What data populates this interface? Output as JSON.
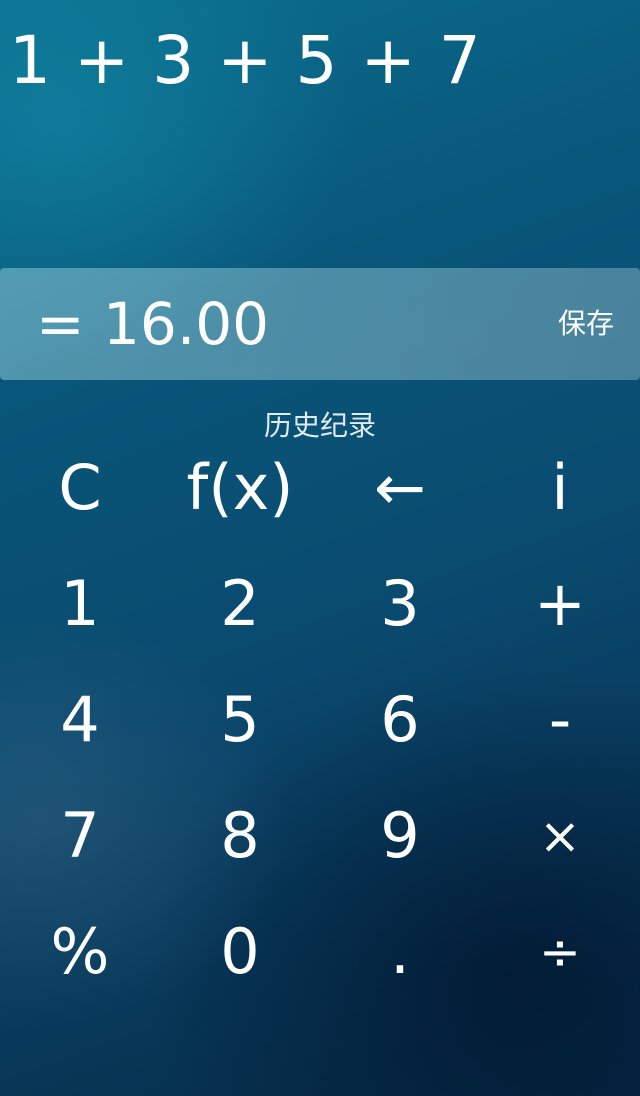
{
  "display": {
    "expression": "1 + 3 + 5 + 7",
    "result": "= 16.00",
    "save_label": "保存"
  },
  "history_label": "历史纪录",
  "keypad": {
    "rows": [
      [
        "C",
        "f(x)",
        "←",
        "i"
      ],
      [
        "1",
        "2",
        "3",
        "+"
      ],
      [
        "4",
        "5",
        "6",
        "-"
      ],
      [
        "7",
        "8",
        "9",
        "×"
      ],
      [
        "%",
        "0",
        ".",
        "÷"
      ]
    ]
  }
}
